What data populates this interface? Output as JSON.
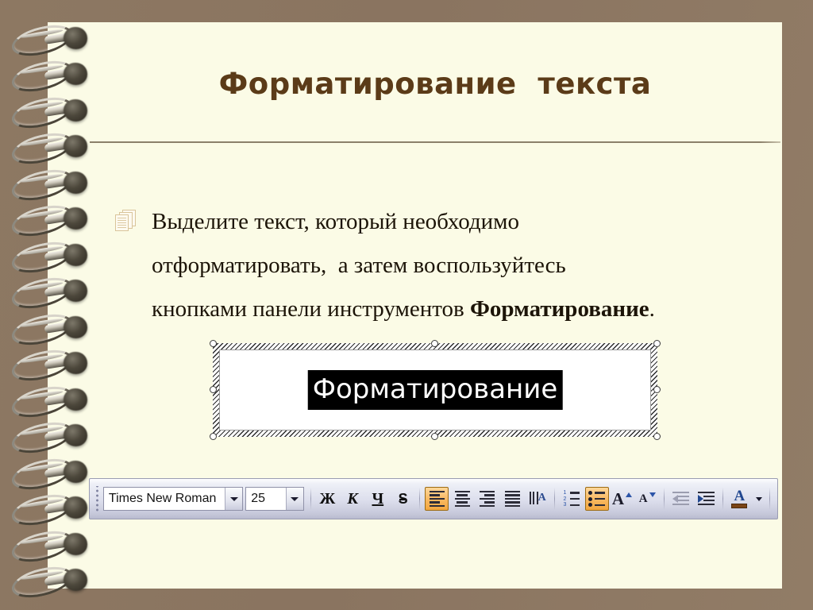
{
  "slide": {
    "title": "Форматирование  текста",
    "background_color": "#8a7460",
    "page_color": "#fbfbe6",
    "title_color": "#5b3b18"
  },
  "body": {
    "bullet_icon": "documents-stack-icon",
    "lines": [
      "Выделите текст, который необходимо",
      "отформатировать,  а затем воспользуйтесь",
      "кнопками панели инструментов "
    ],
    "emphasis": "Форматирование",
    "trailing": "."
  },
  "screenshot_object": {
    "selected_text": "Форматирование",
    "selection_fill": "#000000",
    "selection_text_color": "#ffffff"
  },
  "toolbar": {
    "font_name": "Times New Roman",
    "font_size": "25",
    "buttons": {
      "bold": "Ж",
      "italic": "К",
      "underline": "Ч",
      "strikethrough": "S",
      "align_left": "",
      "align_center": "",
      "align_right": "",
      "align_justify": "",
      "line_spacing": "A",
      "numbered_list": "",
      "bulleted_list": "",
      "grow_font": "A",
      "shrink_font": "A",
      "decrease_indent": "",
      "increase_indent": "",
      "font_color": "A"
    },
    "active_buttons": [
      "align_left",
      "bulleted_list"
    ],
    "highlight_color": "#f2a63f",
    "font_color_swatch": "#7a4416",
    "numbered_list_marks": [
      "1",
      "2",
      "3"
    ]
  },
  "spiral": {
    "coil_count": 16
  }
}
